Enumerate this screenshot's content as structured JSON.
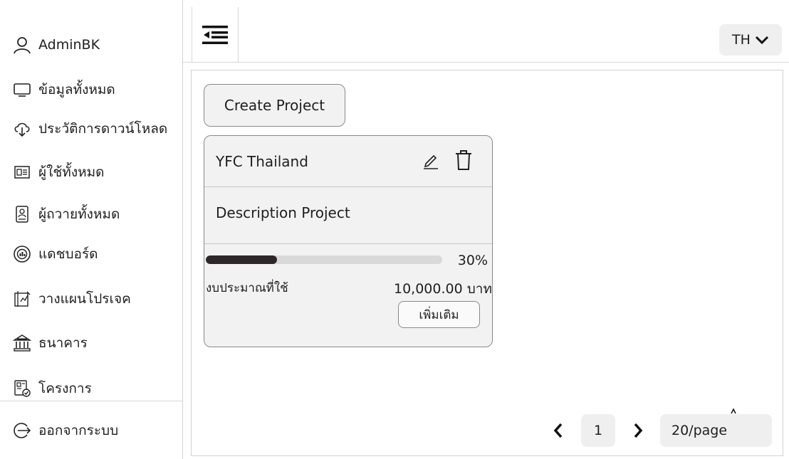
{
  "sidebar": {
    "user": "AdminBK",
    "items": [
      {
        "label": "ข้อมูลทั้งหมด",
        "icon": "monitor-icon"
      },
      {
        "label": "ประวัติการดาวน์โหลด",
        "icon": "cloud-download-icon"
      },
      {
        "label": "ผู้ใช้ทั้งหมด",
        "icon": "id-card-icon"
      },
      {
        "label": "ผู้ถวายทั้งหมด",
        "icon": "document-person-icon"
      },
      {
        "label": "แดชบอร์ด",
        "icon": "dashboard-chart-icon"
      },
      {
        "label": "วางแผนโปรเจค",
        "icon": "plan-board-icon"
      },
      {
        "label": "ธนาคาร",
        "icon": "bank-icon"
      },
      {
        "label": "โครงการ",
        "icon": "project-check-icon"
      }
    ],
    "logout": "ออกจากระบบ"
  },
  "header": {
    "language": "TH"
  },
  "main": {
    "create_button": "Create Project",
    "card": {
      "title": "YFC Thailand",
      "description": "Description Project",
      "progress_percent": 30,
      "progress_label": "30%",
      "budget_label": "งบประมาณที่ใช้",
      "budget_value": "10,000.00 บาท",
      "more_button": "เพิ่มเติม"
    },
    "pagination": {
      "current_page": "1",
      "page_size": "20/page"
    }
  },
  "colors": {
    "progress_fill": "#2e2628",
    "progress_track": "#d9d9d9",
    "card_bg": "#f2f2f2"
  }
}
